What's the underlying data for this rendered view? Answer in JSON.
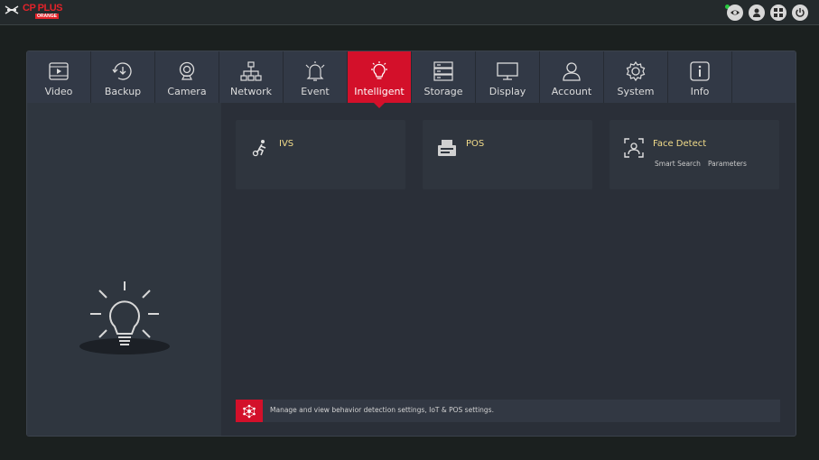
{
  "brand": {
    "name": "CP PLUS",
    "sub": "ORANGE"
  },
  "toolbar": {
    "buttons": [
      "eye-icon",
      "user-icon",
      "grid-icon",
      "power-icon"
    ]
  },
  "tabs": [
    {
      "label": "Video",
      "icon": "video-icon",
      "active": false
    },
    {
      "label": "Backup",
      "icon": "backup-icon",
      "active": false
    },
    {
      "label": "Camera",
      "icon": "camera-icon",
      "active": false
    },
    {
      "label": "Network",
      "icon": "network-icon",
      "active": false
    },
    {
      "label": "Event",
      "icon": "event-icon",
      "active": false
    },
    {
      "label": "Intelligent",
      "icon": "bulb-icon",
      "active": true
    },
    {
      "label": "Storage",
      "icon": "storage-icon",
      "active": false
    },
    {
      "label": "Display",
      "icon": "display-icon",
      "active": false
    },
    {
      "label": "Account",
      "icon": "account-icon",
      "active": false
    },
    {
      "label": "System",
      "icon": "gear-icon",
      "active": false
    },
    {
      "label": "Info",
      "icon": "info-icon",
      "active": false
    }
  ],
  "cards": [
    {
      "title": "IVS",
      "icon": "ivs-icon",
      "links": []
    },
    {
      "title": "POS",
      "icon": "pos-icon",
      "links": []
    },
    {
      "title": "Face Detect",
      "icon": "face-detect-icon",
      "links": [
        "Smart Search",
        "Parameters"
      ]
    }
  ],
  "info_text": "Manage and view behavior detection settings, IoT & POS settings.",
  "colors": {
    "accent": "#d3102a",
    "card_title": "#f2dc8a",
    "background": "#1b201f",
    "panel": "#2a2f38"
  }
}
